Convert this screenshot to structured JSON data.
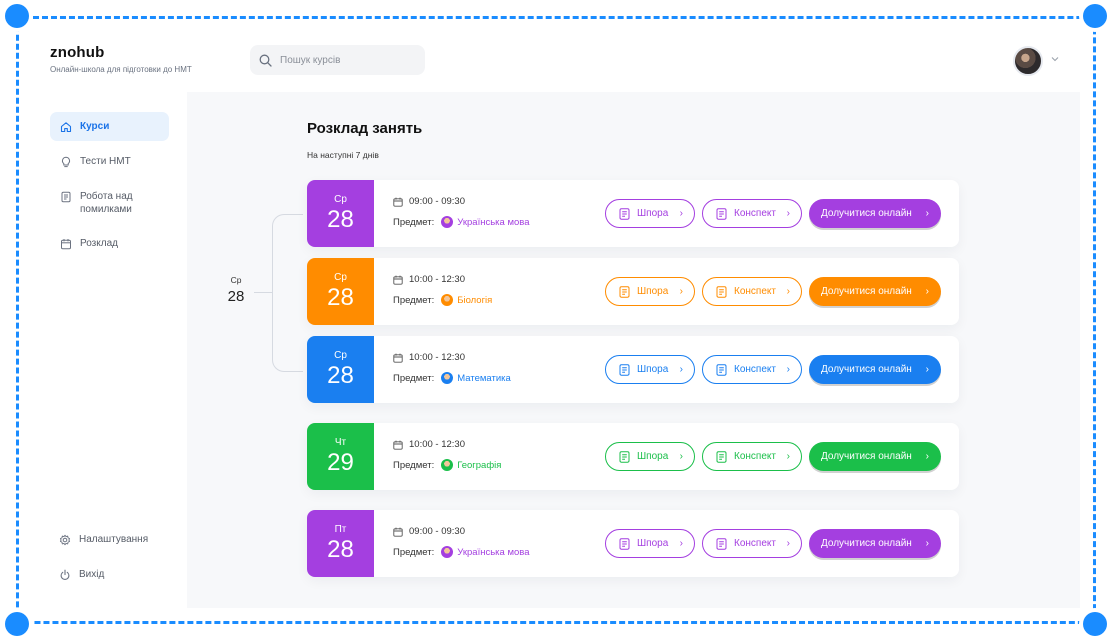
{
  "app": {
    "title": "znohub",
    "subtitle": "Онлайн-школа для підготовки до НМТ"
  },
  "search": {
    "placeholder": "Пошук курсів"
  },
  "sidebar": {
    "items": [
      {
        "label": "Курси",
        "icon": "home-icon",
        "active": true
      },
      {
        "label": "Тести НМТ",
        "icon": "lightbulb-icon"
      },
      {
        "label": "Робота над помилками",
        "icon": "document-icon"
      },
      {
        "label": "Розклад",
        "icon": "calendar-icon"
      }
    ],
    "bottom": [
      {
        "label": "Налаштування",
        "icon": "gear-icon"
      },
      {
        "label": "Вихід",
        "icon": "power-icon"
      }
    ]
  },
  "schedule": {
    "title": "Розклад занять",
    "subtitle": "На наступні 7 днів",
    "group_day": "Ср",
    "group_num": "28",
    "lessons": [
      {
        "day": "Ср",
        "num": "28",
        "time": "09:00 - 09:30",
        "subject_label": "Предмет:",
        "subject": "Українська мова",
        "color": "#a43fe0"
      },
      {
        "day": "Ср",
        "num": "28",
        "time": "10:00 - 12:30",
        "subject_label": "Предмет:",
        "subject": "Біологія",
        "color": "#ff8c00"
      },
      {
        "day": "Ср",
        "num": "28",
        "time": "10:00 - 12:30",
        "subject_label": "Предмет:",
        "subject": "Математика",
        "color": "#1a7ff0"
      },
      {
        "day": "Чт",
        "num": "29",
        "time": "10:00 - 12:30",
        "subject_label": "Предмет:",
        "subject": "Географія",
        "color": "#1bbf4a"
      },
      {
        "day": "Пт",
        "num": "28",
        "time": "09:00 - 09:30",
        "subject_label": "Предмет:",
        "subject": "Українська мова",
        "color": "#a43fe0"
      }
    ],
    "buttons": {
      "cheatsheet": "Шпора",
      "notes": "Конспект",
      "join": "Долучитися онлайн"
    }
  }
}
